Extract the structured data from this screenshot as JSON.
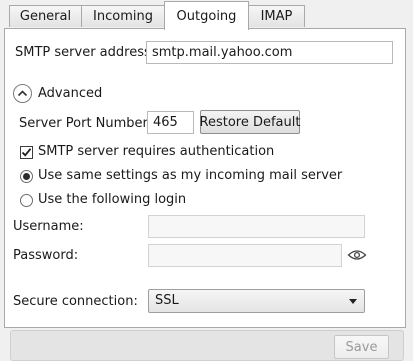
{
  "tabs": [
    {
      "label": "General"
    },
    {
      "label": "Incoming"
    },
    {
      "label": "Outgoing",
      "active": true
    },
    {
      "label": "IMAP"
    }
  ],
  "smtp": {
    "label": "SMTP server address",
    "value": "smtp.mail.yahoo.com"
  },
  "advanced": {
    "label": "Advanced",
    "expanded": true
  },
  "port": {
    "label": "Server Port Number:",
    "value": "465",
    "restore_label": "Restore Default"
  },
  "auth": {
    "requires_auth_label": "SMTP server requires authentication",
    "requires_auth_checked": true,
    "same_settings_label": "Use same settings as my incoming mail server",
    "same_settings_selected": true,
    "following_login_label": "Use the following login",
    "following_login_selected": false
  },
  "credentials": {
    "username_label": "Username:",
    "username_value": "",
    "password_label": "Password:",
    "password_value": ""
  },
  "security": {
    "label": "Secure connection:",
    "value": "SSL"
  },
  "footer": {
    "save_label": "Save",
    "save_enabled": false
  },
  "icons": {
    "expander": "chevron-up-icon",
    "reveal_password": "eye-icon",
    "dropdown": "chevron-down-icon"
  }
}
